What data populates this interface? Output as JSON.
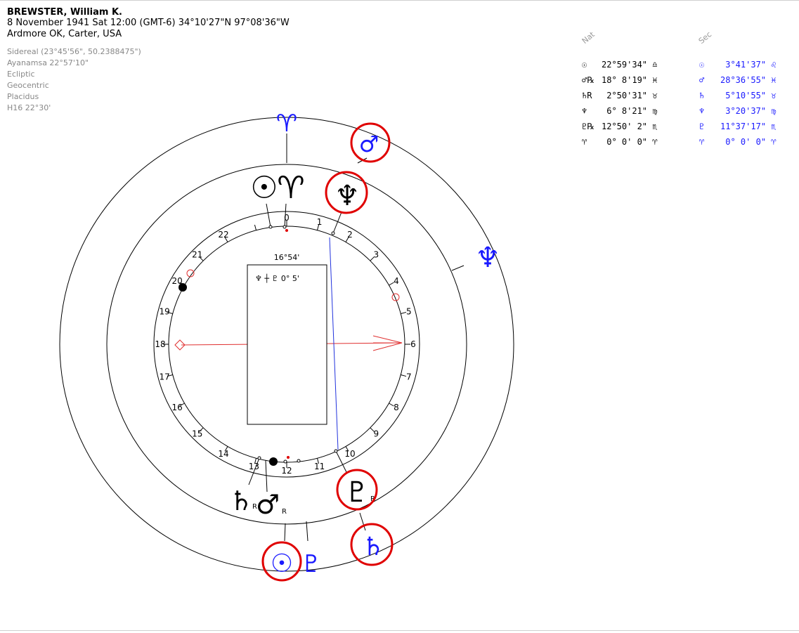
{
  "header": {
    "name": "BREWSTER, William K.",
    "date_line": "8 November 1941  Sat  12:00 (GMT-6) 34°10'27\"N  97°08'36\"W",
    "place_line": "Ardmore OK, Carter, USA",
    "settings": [
      "Sidereal (23°45'56\", 50.2388475\")",
      "Ayanamsa 22°57'10\"",
      "Ecliptic",
      "Geocentric",
      "Placidus",
      "H16  22°30'"
    ]
  },
  "tables": {
    "nat_label": "Nat",
    "sec_label": "Sec",
    "nat_rows": [
      {
        "glyph": "☉",
        "value": "22°59'34\" ♎"
      },
      {
        "glyph": "♂℞",
        "value": "18° 8'19\" ♓"
      },
      {
        "glyph": "♄R",
        "value": " 2°50'31\" ♉"
      },
      {
        "glyph": "♆",
        "value": " 6° 8'21\" ♍"
      },
      {
        "glyph": "♇℞",
        "value": "12°50' 2\" ♏"
      },
      {
        "glyph": "♈",
        "value": " 0° 0' 0\" ♈"
      }
    ],
    "sec_rows": [
      {
        "glyph": "☉",
        "value": " 3°41'37\" ♌"
      },
      {
        "glyph": "♂",
        "value": "28°36'55\" ♓"
      },
      {
        "glyph": "♄",
        "value": " 5°10'55\" ♉"
      },
      {
        "glyph": "♆",
        "value": " 3°20'37\" ♍"
      },
      {
        "glyph": "♇",
        "value": "11°37'17\" ♏"
      },
      {
        "glyph": "♈",
        "value": " 0° 0' 0\" ♈"
      }
    ]
  },
  "chart": {
    "center_degree": "16°54'",
    "aspect_box_text": "♆ ┼ ♇   0° 5'",
    "harmonic_numbers": [
      "0",
      "1",
      "2",
      "3",
      "4",
      "5",
      "6",
      "7",
      "8",
      "9",
      "10",
      "11",
      "12",
      "13",
      "14",
      "15",
      "16",
      "17",
      "18",
      "19",
      "20",
      "21",
      "22"
    ],
    "outer_symbols": {
      "aries_outer": "♈",
      "mars_sec": "♂",
      "neptune_sec": "♆",
      "saturn_sec": "♄",
      "sun_sec": "☉",
      "pluto_sec": "♇"
    },
    "inner_symbols": {
      "sun_nat": "☉",
      "aries_nat": "♈",
      "neptune_nat": "♆",
      "pluto_nat": "♇",
      "saturn_nat": "♄",
      "mars_nat": "♂",
      "retro_saturn": "R",
      "retro_mars": "R",
      "retro_pluto": "R"
    },
    "colors": {
      "natal": "#000000",
      "secondary": "#1a1aff",
      "highlight": "#e00000",
      "axis": "#e03030",
      "aspect": "#2233dd"
    }
  }
}
